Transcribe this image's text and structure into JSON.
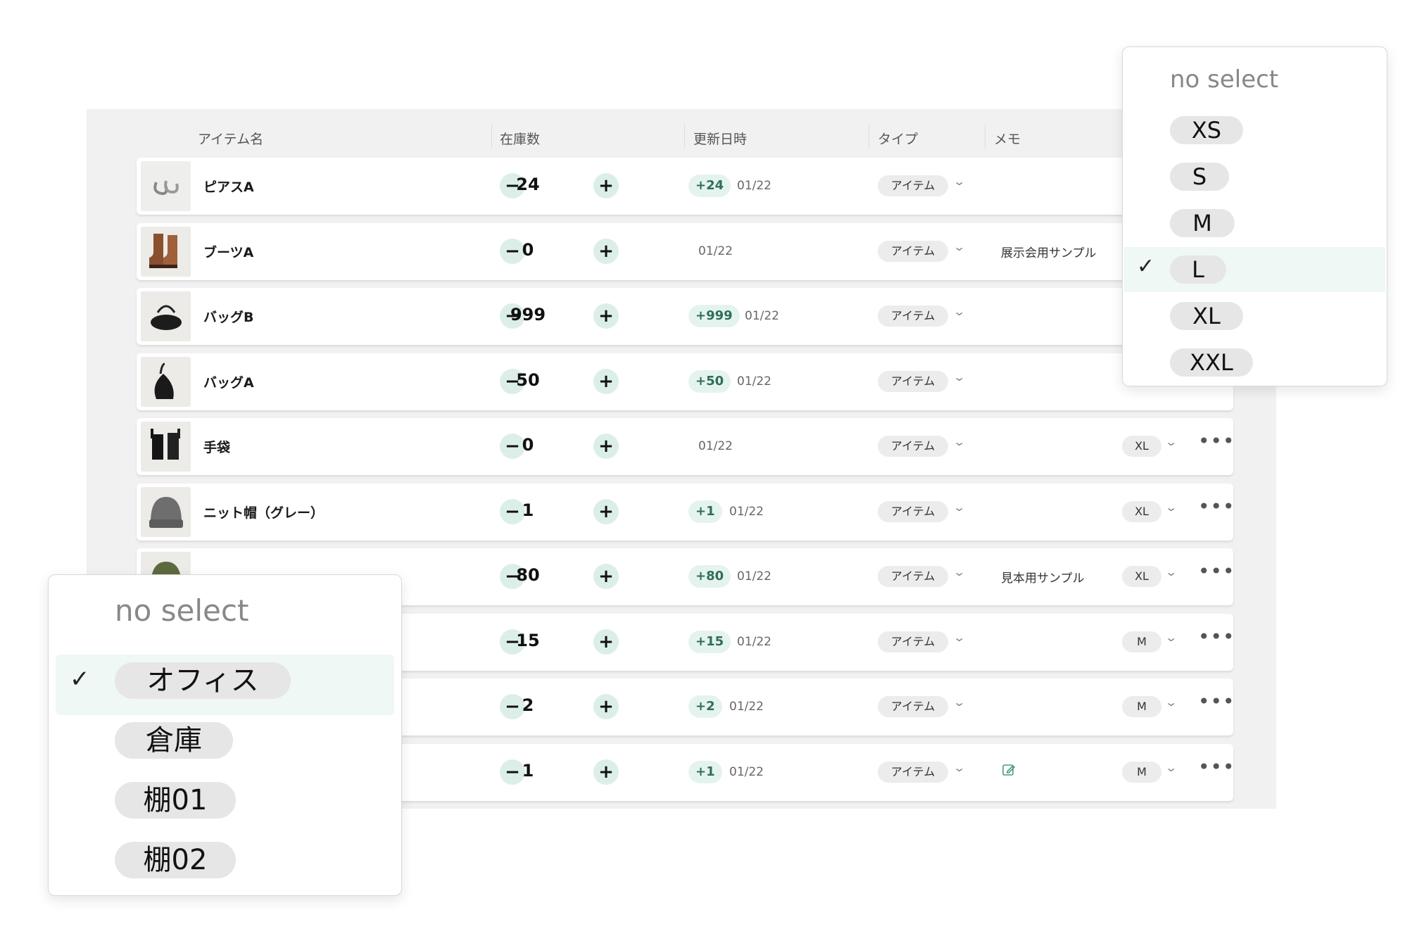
{
  "columns": {
    "name": "アイテム名",
    "stock": "在庫数",
    "updated": "更新日時",
    "type": "タイプ",
    "memo": "メモ"
  },
  "stepper": {
    "minus": "−",
    "plus": "+"
  },
  "chevron": "⌄",
  "more_glyph": "•••",
  "rows": [
    {
      "name": "ピアスA",
      "qty": "24",
      "delta": "+24",
      "date": "01/22",
      "type": "アイテム",
      "memo": "",
      "size": "",
      "thumb": "earring"
    },
    {
      "name": "ブーツA",
      "qty": "0",
      "delta": "",
      "date": "01/22",
      "type": "アイテム",
      "memo": "展示会用サンプル",
      "size": "",
      "thumb": "boots"
    },
    {
      "name": "バッグB",
      "qty": "999",
      "delta": "+999",
      "date": "01/22",
      "type": "アイテム",
      "memo": "",
      "size": "",
      "thumb": "duffel"
    },
    {
      "name": "バッグA",
      "qty": "50",
      "delta": "+50",
      "date": "01/22",
      "type": "アイテム",
      "memo": "",
      "size": "",
      "thumb": "hobo"
    },
    {
      "name": "手袋",
      "qty": "0",
      "delta": "",
      "date": "01/22",
      "type": "アイテム",
      "memo": "",
      "size": "XL",
      "thumb": "gloves"
    },
    {
      "name": "ニット帽（グレー）",
      "qty": "1",
      "delta": "+1",
      "date": "01/22",
      "type": "アイテム",
      "memo": "",
      "size": "XL",
      "thumb": "beanie"
    },
    {
      "name": "",
      "qty": "80",
      "delta": "+80",
      "date": "01/22",
      "type": "アイテム",
      "memo": "見本用サンプル",
      "size": "XL",
      "thumb": "beanie-green"
    },
    {
      "name": "",
      "qty": "15",
      "delta": "+15",
      "date": "01/22",
      "type": "アイテム",
      "memo": "",
      "size": "M",
      "thumb": ""
    },
    {
      "name": "",
      "qty": "2",
      "delta": "+2",
      "date": "01/22",
      "type": "アイテム",
      "memo": "",
      "size": "M",
      "thumb": ""
    },
    {
      "name": "",
      "qty": "1",
      "delta": "+1",
      "date": "01/22",
      "type": "アイテム",
      "memo": "edit-icon",
      "size": "M",
      "thumb": ""
    }
  ],
  "size_dropdown": {
    "none_label": "no select",
    "options": [
      "XS",
      "S",
      "M",
      "L",
      "XL",
      "XXL"
    ],
    "selected": "L"
  },
  "location_dropdown": {
    "none_label": "no select",
    "options": [
      "オフィス",
      "倉庫",
      "棚01",
      "棚02"
    ],
    "selected": "オフィス"
  },
  "colors": {
    "accent_bg": "#dceee8",
    "delta_text": "#2f6e5a",
    "highlight": "#eff8f5"
  }
}
